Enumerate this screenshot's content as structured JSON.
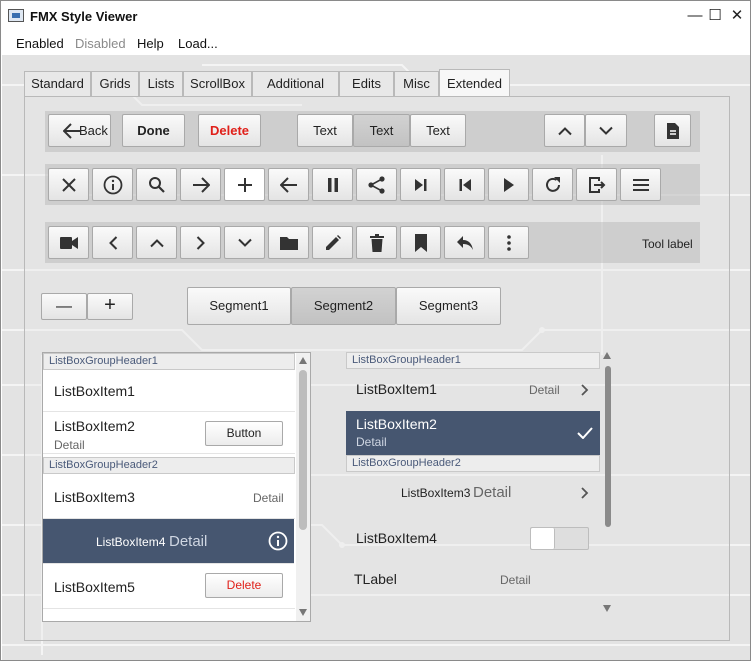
{
  "window": {
    "title": "FMX Style Viewer",
    "controls": {
      "minimize": "—",
      "maximize": "☐",
      "close": "✕"
    }
  },
  "menu": {
    "items": [
      {
        "label": "Enabled",
        "enabled": true
      },
      {
        "label": "Disabled",
        "enabled": false
      },
      {
        "label": "Help",
        "enabled": true
      },
      {
        "label": "Load...",
        "enabled": true
      }
    ]
  },
  "tabs": [
    {
      "label": "Standard",
      "active": false
    },
    {
      "label": "Grids",
      "active": false
    },
    {
      "label": "Lists",
      "active": false
    },
    {
      "label": "ScrollBox",
      "active": false
    },
    {
      "label": "Additional",
      "active": false
    },
    {
      "label": "Edits",
      "active": false
    },
    {
      "label": "Misc",
      "active": false
    },
    {
      "label": "Extended",
      "active": true
    }
  ],
  "toolbar1": {
    "back_label": "Back",
    "done_label": "Done",
    "delete_label": "Delete",
    "segments": [
      "Text",
      "Text",
      "Text"
    ],
    "selected_segment": 1,
    "icons": [
      "chevron-up-icon",
      "chevron-down-icon",
      "document-icon"
    ]
  },
  "toolbar2": {
    "icons": [
      "close-icon",
      "info-icon",
      "search-icon",
      "arrow-right-icon",
      "add-icon",
      "arrow-left-icon",
      "pause-icon",
      "share-icon",
      "skip-next-icon",
      "skip-previous-icon",
      "play-icon",
      "refresh-icon",
      "exit-icon",
      "menu-icon"
    ]
  },
  "toolbar3": {
    "icons": [
      "camera-icon",
      "chevron-left-icon",
      "chevron-up-icon",
      "chevron-right-icon",
      "chevron-down-icon",
      "folder-icon",
      "pencil-icon",
      "trash-icon",
      "bookmark-icon",
      "reply-icon",
      "more-vertical-icon"
    ],
    "tool_label": "Tool label"
  },
  "stepper": {
    "minus": "—",
    "plus": "+"
  },
  "segment_control": {
    "segments": [
      "Segment1",
      "Segment2",
      "Segment3"
    ],
    "selected": 1
  },
  "listbox_left": {
    "group1": "ListBoxGroupHeader1",
    "item1": "ListBoxItem1",
    "item2": "ListBoxItem2",
    "item2_detail": "Detail",
    "item2_button": "Button",
    "group2": "ListBoxGroupHeader2",
    "item3": "ListBoxItem3",
    "item3_detail": "Detail",
    "item4": "ListBoxItem4",
    "item4_detail": "Detail",
    "item5": "ListBoxItem5",
    "item5_button": "Delete"
  },
  "listbox_right": {
    "group1": "ListBoxGroupHeader1",
    "item1": "ListBoxItem1",
    "item1_detail": "Detail",
    "item2": "ListBoxItem2",
    "item2_detail": "Detail",
    "group2": "ListBoxGroupHeader2",
    "item3": "ListBoxItem3",
    "item3_detail": "Detail",
    "item4": "ListBoxItem4",
    "item5": "TLabel",
    "item5_detail": "Detail"
  },
  "colors": {
    "selection": "#465670",
    "delete_red": "#e0201a",
    "group_header_text": "#4a5a7a"
  }
}
